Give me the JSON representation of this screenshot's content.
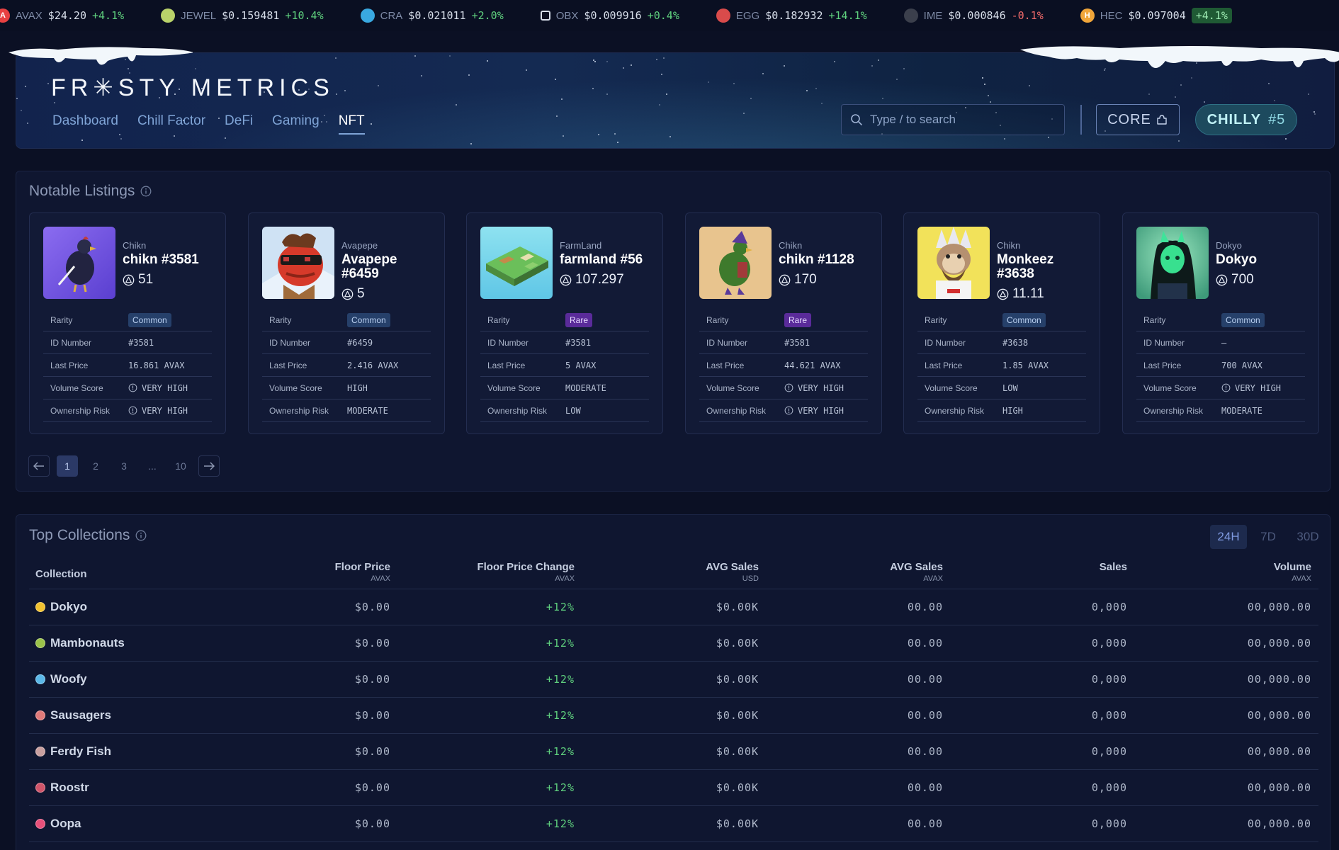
{
  "ticker": [
    {
      "symbol": "AVAX",
      "price": "$24.20",
      "change": "+4.1%",
      "dir": "up",
      "color": "#e84142",
      "glyph": "A",
      "badge": false
    },
    {
      "symbol": "JEWEL",
      "price": "$0.159481",
      "change": "+10.4%",
      "dir": "up",
      "color": "#b9d26a",
      "glyph": "",
      "badge": false
    },
    {
      "symbol": "CRA",
      "price": "$0.021011",
      "change": "+2.0%",
      "dir": "up",
      "color": "#39a8e0",
      "glyph": "",
      "badge": false
    },
    {
      "symbol": "OBX",
      "price": "$0.009916",
      "change": "+0.4%",
      "dir": "up",
      "color": "#0a0f22",
      "glyph": "",
      "badge": false
    },
    {
      "symbol": "EGG",
      "price": "$0.182932",
      "change": "+14.1%",
      "dir": "up",
      "color": "#d94b4b",
      "glyph": "",
      "badge": false
    },
    {
      "symbol": "IME",
      "price": "$0.000846",
      "change": "-0.1%",
      "dir": "down",
      "color": "#3b3f4c",
      "glyph": "",
      "badge": false
    },
    {
      "symbol": "HEC",
      "price": "$0.097004",
      "change": "+4.1%",
      "dir": "up",
      "color": "#f0a53a",
      "glyph": "H",
      "badge": true
    }
  ],
  "header": {
    "logo": "FR✳STY METRICS",
    "nav": [
      "Dashboard",
      "Chill Factor",
      "DeFi",
      "Gaming",
      "NFT"
    ],
    "active_nav": "NFT",
    "search_placeholder": "Type / to search",
    "core_label": "CORE",
    "chilly_label": "CHILLY",
    "chilly_rank": "#5"
  },
  "listings": {
    "title": "Notable Listings",
    "labels": {
      "rarity": "Rarity",
      "id": "ID Number",
      "last_price": "Last Price",
      "volume": "Volume Score",
      "risk": "Ownership Risk"
    },
    "cards": [
      {
        "collection": "Chikn",
        "name": "chikn #3581",
        "price": "51",
        "rarity": "Common",
        "id": "#3581",
        "last_price": "16.861 AVAX",
        "volume": "VERY HIGH",
        "volume_warn": true,
        "risk": "VERY HIGH",
        "risk_warn": true,
        "art": "chikn-purple"
      },
      {
        "collection": "Avapepe",
        "name": "Avapepe #6459",
        "price": "5",
        "rarity": "Common",
        "id": "#6459",
        "last_price": "2.416 AVAX",
        "volume": "HIGH",
        "volume_warn": false,
        "risk": "MODERATE",
        "risk_warn": false,
        "art": "pepe"
      },
      {
        "collection": "FarmLand",
        "name": "farmland #56",
        "price": "107.297",
        "rarity": "Rare",
        "id": "#3581",
        "last_price": "5 AVAX",
        "volume": "MODERATE",
        "volume_warn": false,
        "risk": "LOW",
        "risk_warn": false,
        "art": "farmland"
      },
      {
        "collection": "Chikn",
        "name": "chikn #1128",
        "price": "170",
        "rarity": "Rare",
        "id": "#3581",
        "last_price": "44.621 AVAX",
        "volume": "VERY HIGH",
        "volume_warn": true,
        "risk": "VERY HIGH",
        "risk_warn": true,
        "art": "chikn-green"
      },
      {
        "collection": "Chikn",
        "name": "Monkeez #3638",
        "price": "11.11",
        "rarity": "Common",
        "id": "#3638",
        "last_price": "1.85 AVAX",
        "volume": "LOW",
        "volume_warn": false,
        "risk": "HIGH",
        "risk_warn": false,
        "art": "monkeez"
      },
      {
        "collection": "Dokyo",
        "name": "Dokyo",
        "price": "700",
        "rarity": "Common",
        "id": "–",
        "last_price": "700 AVAX",
        "volume": "VERY HIGH",
        "volume_warn": true,
        "risk": "MODERATE",
        "risk_warn": false,
        "art": "dokyo"
      }
    ],
    "pager": {
      "pages": [
        "1",
        "2",
        "3",
        "...",
        "10"
      ],
      "active": "1"
    }
  },
  "collections": {
    "title": "Top Collections",
    "ranges": [
      "24H",
      "7D",
      "30D"
    ],
    "active_range": "24H",
    "columns": [
      {
        "label": "Collection",
        "unit": ""
      },
      {
        "label": "Floor Price",
        "unit": "AVAX"
      },
      {
        "label": "Floor Price Change",
        "unit": "AVAX"
      },
      {
        "label": "AVG Sales",
        "unit": "USD"
      },
      {
        "label": "AVG Sales",
        "unit": "AVAX"
      },
      {
        "label": "Sales",
        "unit": ""
      },
      {
        "label": "Volume",
        "unit": "AVAX"
      }
    ],
    "rows": [
      {
        "name": "Dokyo",
        "dot": "#f2c230",
        "floor": "$0.00",
        "change": "+12%",
        "avg_usd": "$0.00K",
        "avg_avax": "00.00",
        "sales": "0,000",
        "volume": "00,000.00"
      },
      {
        "name": "Mambonauts",
        "dot": "#9bc34a",
        "floor": "$0.00",
        "change": "+12%",
        "avg_usd": "$0.00K",
        "avg_avax": "00.00",
        "sales": "0,000",
        "volume": "00,000.00"
      },
      {
        "name": "Woofy",
        "dot": "#5bb8e8",
        "floor": "$0.00",
        "change": "+12%",
        "avg_usd": "$0.00K",
        "avg_avax": "00.00",
        "sales": "0,000",
        "volume": "00,000.00"
      },
      {
        "name": "Sausagers",
        "dot": "#e07a7a",
        "floor": "$0.00",
        "change": "+12%",
        "avg_usd": "$0.00K",
        "avg_avax": "00.00",
        "sales": "0,000",
        "volume": "00,000.00"
      },
      {
        "name": "Ferdy Fish",
        "dot": "#c9a0a0",
        "floor": "$0.00",
        "change": "+12%",
        "avg_usd": "$0.00K",
        "avg_avax": "00.00",
        "sales": "0,000",
        "volume": "00,000.00"
      },
      {
        "name": "Roostr",
        "dot": "#d0556a",
        "floor": "$0.00",
        "change": "+12%",
        "avg_usd": "$0.00K",
        "avg_avax": "00.00",
        "sales": "0,000",
        "volume": "00,000.00"
      },
      {
        "name": "Oopa",
        "dot": "#e8507a",
        "floor": "$0.00",
        "change": "+12%",
        "avg_usd": "$0.00K",
        "avg_avax": "00.00",
        "sales": "0,000",
        "volume": "00,000.00"
      }
    ]
  }
}
